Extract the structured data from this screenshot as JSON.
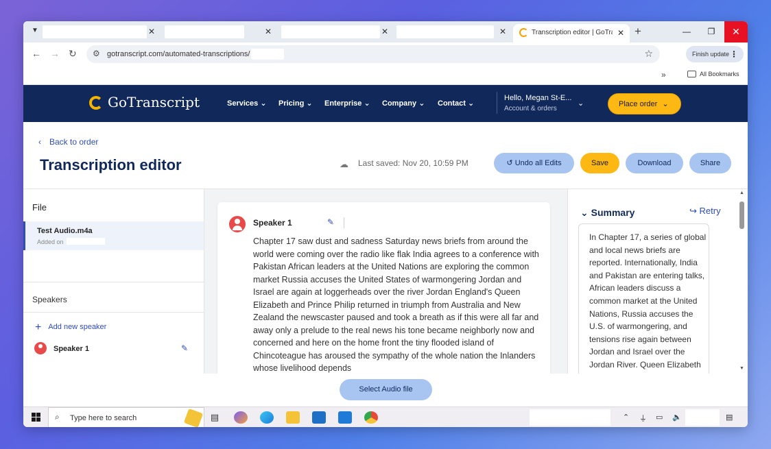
{
  "browser": {
    "active_tab_title": "Transcription editor | GoTranscript",
    "new_tab_icon": "+",
    "url": "gotranscript.com/automated-transcriptions/",
    "finish_update_label": "Finish update",
    "bookmarks_label": "All Bookmarks"
  },
  "site_nav": {
    "logo": "GoTranscript",
    "items": [
      "Services",
      "Pricing",
      "Enterprise",
      "Company",
      "Contact"
    ],
    "greeting": "Hello, Megan St-E...",
    "account_label": "Account & orders",
    "place_order_label": "Place order"
  },
  "header": {
    "back_label": "Back to order",
    "title": "Transcription editor",
    "last_saved": "Last saved: Nov 20, 10:59 PM",
    "undo_label": "Undo all Edits",
    "save_label": "Save",
    "download_label": "Download",
    "share_label": "Share"
  },
  "left_panel": {
    "file_heading": "File",
    "file_name": "Test Audio.m4a",
    "added_on_label": "Added on",
    "speakers_heading": "Speakers",
    "add_speaker_label": "Add new speaker",
    "speakers": [
      "Speaker 1"
    ]
  },
  "transcript": {
    "speaker": "Speaker 1",
    "text": "Chapter 17 saw dust and sadness Saturday news briefs from around the world were coming over the radio like flak India agrees to a conference with Pakistan African leaders at the United Nations are exploring the common market Russia accuses the United States of warmongering Jordan and Israel are again at loggerheads over the river Jordan England's Queen Elizabeth and Prince Philip returned in triumph from Australia and New Zealand the newscaster paused and took a breath as if this were all far and away only a prelude to the real news his tone became neighborly now and concerned and here on the home front the tiny flooded island of Chincoteague has aroused the sympathy of the whole nation the Inlanders whose livelihood depends"
  },
  "summary": {
    "heading": "Summary",
    "retry_label": "Retry",
    "text": "In Chapter 17, a series of global and local news briefs are reported. Internationally, India and Pakistan are entering talks, African leaders discuss a common market at the United Nations, Russia accuses the U.S. of warmongering, and tensions rise again between Jordan and Israel over the Jordan River. Queen Elizabeth"
  },
  "footer": {
    "select_audio_label": "Select Audio file"
  },
  "taskbar": {
    "search_placeholder": "Type here to search"
  },
  "colors": {
    "nav_bg": "#10285a",
    "accent_yellow": "#fdb813",
    "accent_blue": "#a8c4f1",
    "link_blue": "#2f4db5",
    "speaker_red": "#e84a4a",
    "close_red": "#e81123"
  },
  "icons": [
    "chevron-down-icon",
    "close-icon",
    "plus-icon",
    "back-arrow-icon",
    "forward-arrow-icon",
    "reload-icon",
    "site-settings-icon",
    "star-icon",
    "more-vert-icon",
    "folder-icon",
    "cloud-icon",
    "undo-icon",
    "pencil-icon",
    "retry-icon",
    "avatar-icon",
    "windows-logo-icon",
    "search-icon"
  ]
}
